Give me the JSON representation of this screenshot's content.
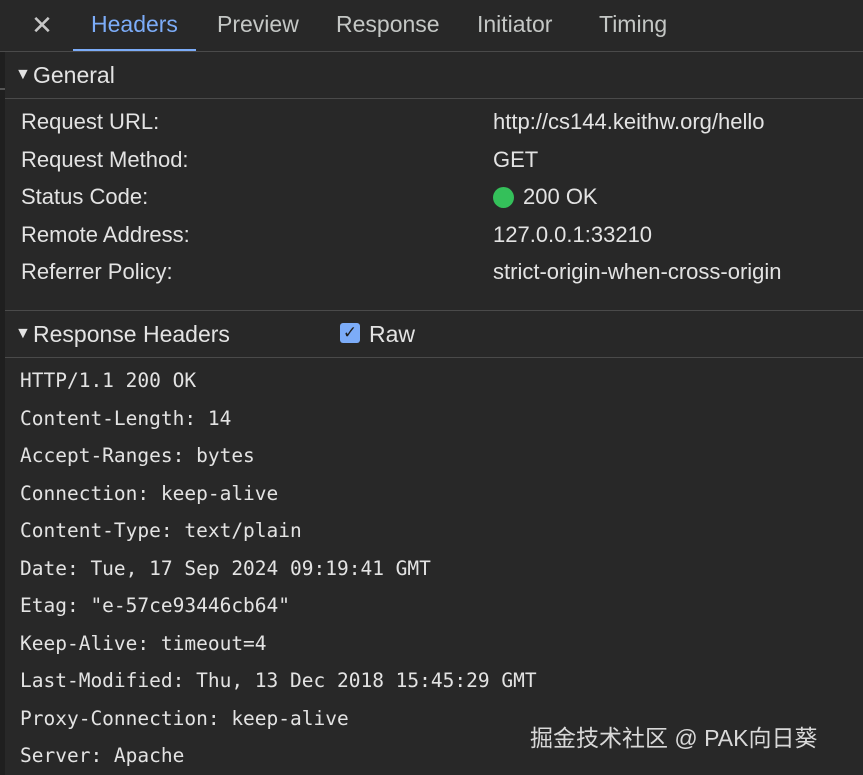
{
  "tabs": [
    {
      "label": "Headers",
      "active": true
    },
    {
      "label": "Preview",
      "active": false
    },
    {
      "label": "Response",
      "active": false
    },
    {
      "label": "Initiator",
      "active": false
    },
    {
      "label": "Timing",
      "active": false
    }
  ],
  "close_glyph": "✕",
  "general": {
    "caret": "▼",
    "title": "General",
    "rows": [
      {
        "key": "Request URL:",
        "value": "http://cs144.keithw.org/hello"
      },
      {
        "key": "Request Method:",
        "value": "GET"
      },
      {
        "key": "Status Code:",
        "value": "200 OK"
      },
      {
        "key": "Remote Address:",
        "value": "127.0.0.1:33210"
      },
      {
        "key": "Referrer Policy:",
        "value": "strict-origin-when-cross-origin"
      }
    ],
    "status_color": "#34c05a"
  },
  "response_headers": {
    "caret": "▼",
    "title": "Response Headers",
    "raw_label": "Raw",
    "raw_checked": true,
    "check_glyph": "✓",
    "lines": [
      "HTTP/1.1 200 OK",
      "Content-Length: 14",
      "Accept-Ranges: bytes",
      "Connection: keep-alive",
      "Content-Type: text/plain",
      "Date: Tue, 17 Sep 2024 09:19:41 GMT",
      "Etag: \"e-57ce93446cb64\"",
      "Keep-Alive: timeout=4",
      "Last-Modified: Thu, 13 Dec 2018 15:45:29 GMT",
      "Proxy-Connection: keep-alive",
      "Server: Apache"
    ]
  },
  "watermark": "掘金技术社区 @ PAK向日葵",
  "colors": {
    "background": "#282828",
    "accent": "#7cacf8",
    "text": "#e3e3e3",
    "divider": "#4a4a4a"
  }
}
